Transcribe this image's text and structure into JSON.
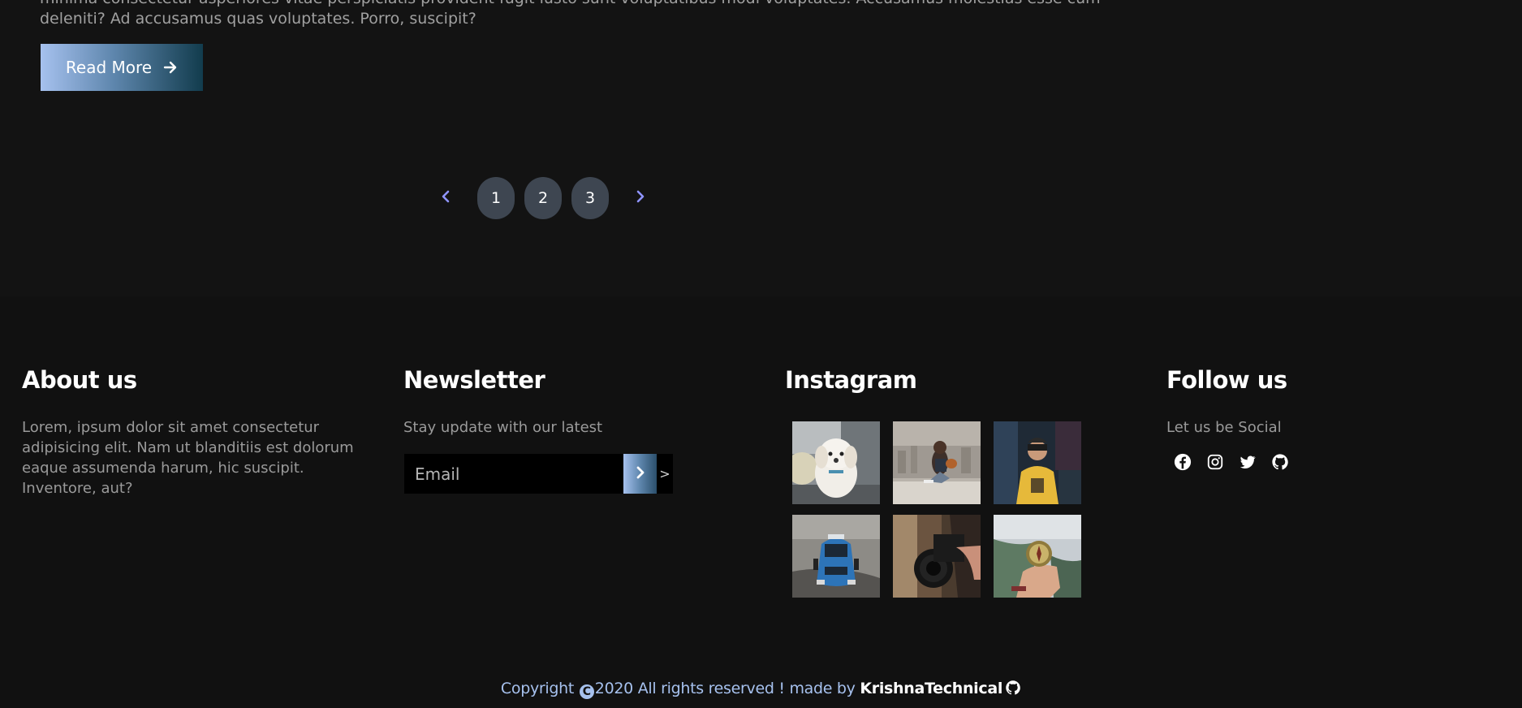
{
  "blog": {
    "excerpt_line1": "minima consectetur asperiores vitae perspiciatis provident fugit iusto sunt voluptatibus modi voluptates. Accusamus molestias esse cum",
    "excerpt_line2": "deleniti? Ad accusamus quas voluptates. Porro, suscipit?",
    "read_more_label": "Read More",
    "read_more_icon": "arrow-right-icon"
  },
  "pagination": {
    "prev_icon": "chevron-left-icon",
    "next_icon": "chevron-right-icon",
    "pages": [
      "1",
      "2",
      "3"
    ]
  },
  "footer": {
    "about": {
      "title": "About us",
      "text": "Lorem, ipsum dolor sit amet consectetur adipisicing elit. Nam ut blanditiis est dolorum eaque assumenda harum, hic suscipit. Inventore, aut?"
    },
    "newsletter": {
      "title": "Newsletter",
      "text": "Stay update with our latest",
      "email_placeholder": "Email",
      "submit_icon": "chevron-right-icon",
      "submit_text": ">"
    },
    "instagram": {
      "title": "Instagram",
      "images": [
        "dog-photo",
        "woman-sitting-city-photo",
        "man-yellow-sweater-photo",
        "blue-car-photo",
        "camera-lens-photo",
        "hand-compass-photo"
      ]
    },
    "follow": {
      "title": "Follow us",
      "text": "Let us be Social",
      "icons": [
        "facebook-icon",
        "instagram-icon",
        "twitter-icon",
        "github-icon"
      ]
    },
    "copyright": {
      "prefix": "Copyright",
      "symbol": "C",
      "text": "2020 All rights reserved ! made by",
      "brand": "KrishnaTechnical",
      "icon": "github-icon"
    }
  },
  "colors": {
    "background": "#131313",
    "footer_background": "#111111",
    "accent": "#a6c1ee",
    "page_button": "#3e4651",
    "arrow": "#8f94ff"
  }
}
